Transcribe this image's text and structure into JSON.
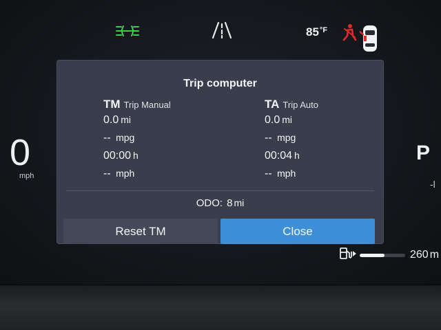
{
  "status_bar": {
    "outside_temp": "85",
    "temp_unit": "°F",
    "icons": [
      "headlights-on-icon",
      "lane-assist-icon",
      "seatbelt-warning-icon",
      "car-doors-icon"
    ],
    "colors": {
      "headlights": "#3fd14a",
      "seatbelt": "#e02a2a"
    }
  },
  "speedometer": {
    "value": "0",
    "unit": "mph"
  },
  "gear": {
    "value": "P",
    "sub": "-l"
  },
  "range": {
    "value": "260",
    "unit": "m",
    "fuel_level_fraction": 0.55
  },
  "trip_dialog": {
    "title": "Trip computer",
    "manual": {
      "abbr": "TM",
      "name": "Trip Manual",
      "distance": "0.0",
      "distance_unit": "mi",
      "economy": "-- ",
      "economy_unit": "mpg",
      "time": "00:00",
      "time_unit": "h",
      "avg_speed": "-- ",
      "avg_speed_unit": "mph"
    },
    "auto": {
      "abbr": "TA",
      "name": "Trip Auto",
      "distance": "0.0",
      "distance_unit": "mi",
      "economy": "-- ",
      "economy_unit": "mpg",
      "time": "00:04",
      "time_unit": "h",
      "avg_speed": "-- ",
      "avg_speed_unit": "mph"
    },
    "odo_label": "ODO:",
    "odo_value": "8",
    "odo_unit": "mi",
    "reset_label": "Reset TM",
    "close_label": "Close",
    "accent_color": "#3d8fd8"
  }
}
